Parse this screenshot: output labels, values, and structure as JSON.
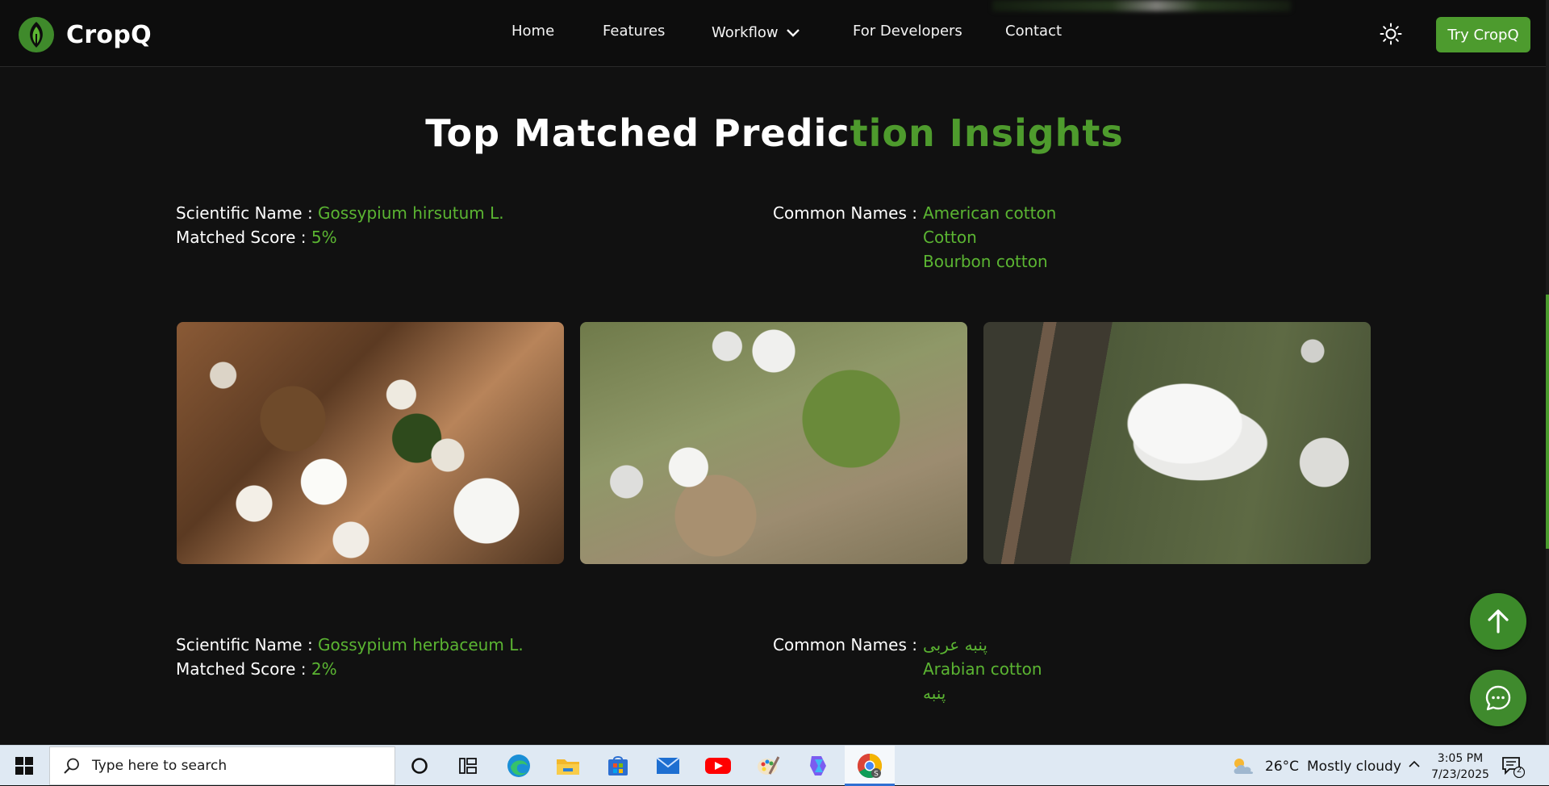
{
  "nav": {
    "brand": "CropQ",
    "links": [
      "Home",
      "Features",
      "Workflow",
      "For Developers",
      "Contact"
    ],
    "cta": "Try CropQ",
    "theme_icon": "sun-icon",
    "accent": "#4d9b2e"
  },
  "heading": {
    "part_white": "Top Matched Predic",
    "part_green": "tion Insights"
  },
  "results": [
    {
      "scientific_label": "Scientific Name :",
      "scientific_name": "Gossypium hirsutum L.",
      "score_label": "Matched Score :",
      "score": "5%",
      "common_label": "Common Names :",
      "common_names": [
        "American cotton",
        "Cotton",
        "Bourbon cotton"
      ],
      "photos": [
        "cotton-field-photo",
        "cotton-plants-photo",
        "cotton-boll-photo"
      ]
    },
    {
      "scientific_label": "Scientific Name :",
      "scientific_name": "Gossypium herbaceum L.",
      "score_label": "Matched Score :",
      "score": "2%",
      "common_label": "Common Names :",
      "common_names": [
        "پنبه عربی",
        "Arabian cotton",
        "پنبه"
      ]
    }
  ],
  "taskbar": {
    "search_placeholder": "Type here to search",
    "weather_temp": "26°C",
    "weather_desc": "Mostly cloudy",
    "time": "3:05 PM",
    "date": "7/23/2025",
    "notification_count": "2",
    "apps": [
      "cortana-icon",
      "task-view-icon",
      "edge-icon",
      "file-explorer-icon",
      "store-icon",
      "mail-icon",
      "youtube-icon",
      "paint-icon",
      "copilot-icon",
      "chrome-icon"
    ]
  }
}
